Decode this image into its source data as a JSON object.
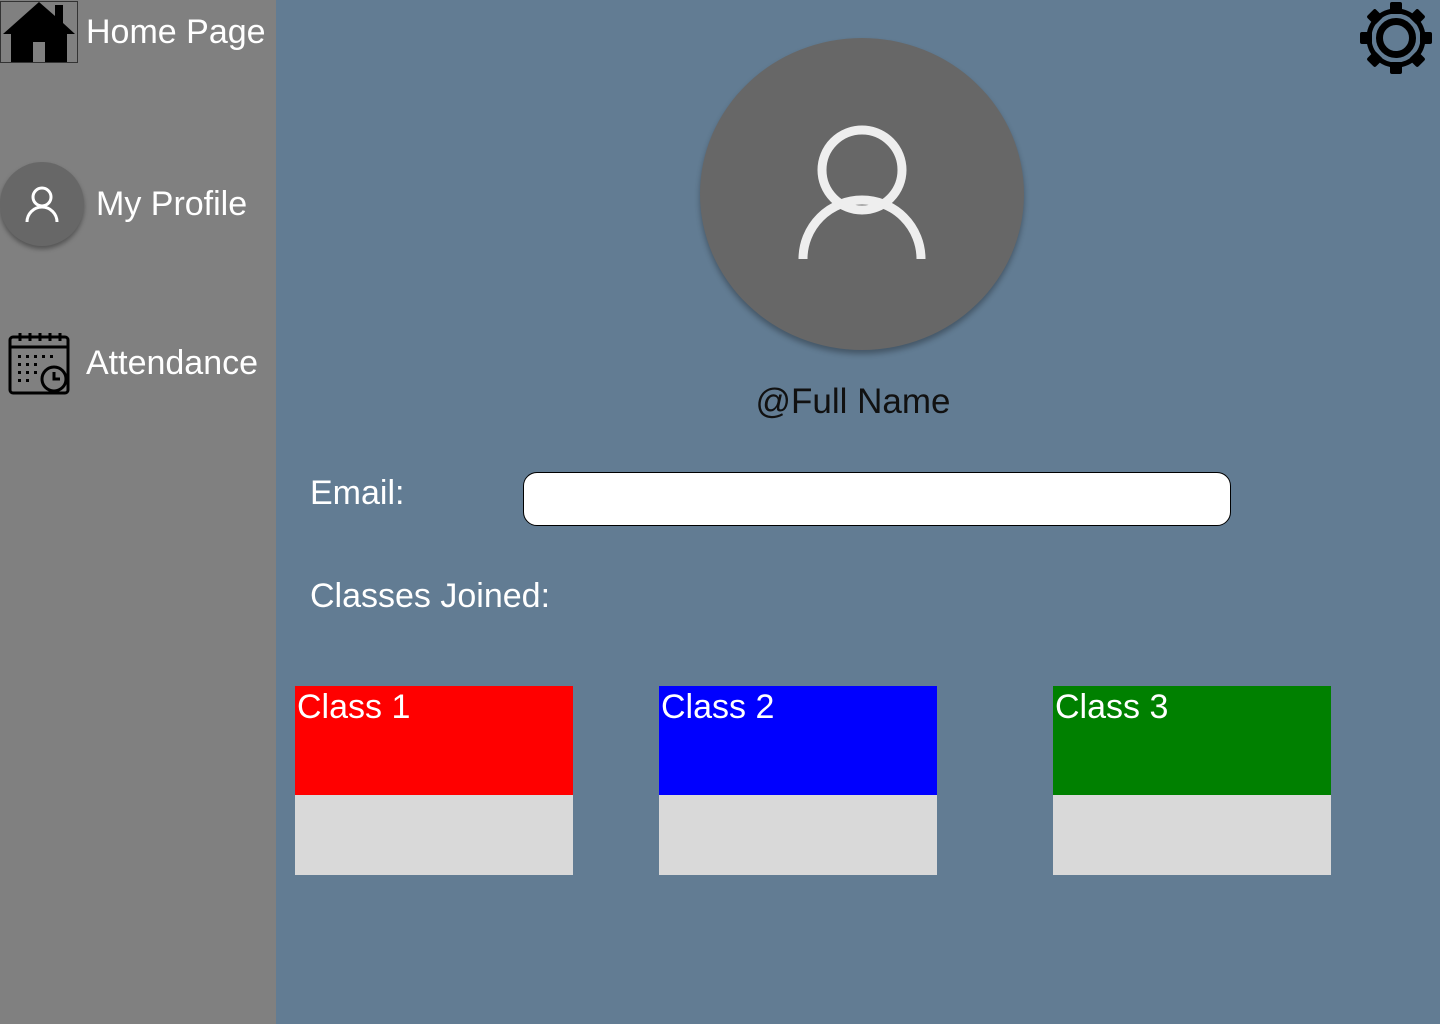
{
  "sidebar": {
    "items": [
      {
        "label": "Home Page",
        "icon": "home-icon"
      },
      {
        "label": "My Profile",
        "icon": "user-icon"
      },
      {
        "label": "Attendance",
        "icon": "calendar-clock-icon"
      }
    ]
  },
  "header": {
    "settings_icon": "gear-icon"
  },
  "profile": {
    "name": "@Full Name",
    "email_label": "Email:",
    "email_value": "",
    "classes_label": "Classes Joined:"
  },
  "classes": [
    {
      "title": "Class 1",
      "color": "#ff0000"
    },
    {
      "title": "Class 2",
      "color": "#0000ff"
    },
    {
      "title": "Class 3",
      "color": "#008000"
    }
  ],
  "colors": {
    "sidebar": "#808080",
    "main": "#627c93",
    "avatar": "#676767",
    "card_bottom": "#d9d9d9"
  }
}
